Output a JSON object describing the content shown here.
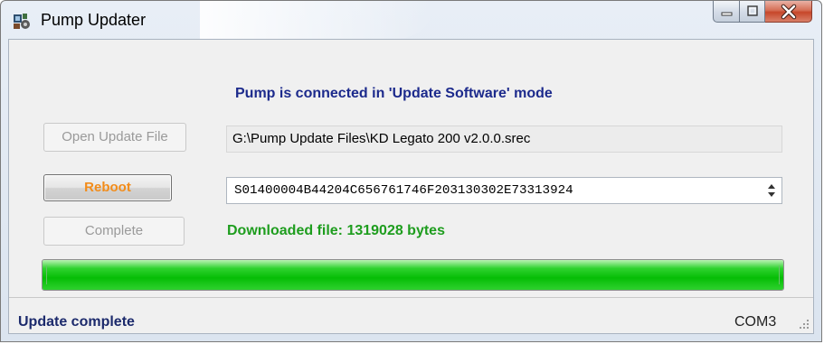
{
  "window": {
    "title": "Pump Updater",
    "icon": "pump-updater-app-icon",
    "caption_buttons": [
      "minimize-icon",
      "maximize-icon",
      "close-icon"
    ]
  },
  "main": {
    "connection_status": "Pump is connected in 'Update Software' mode",
    "open_file_button": "Open Update File",
    "file_path": "G:\\Pump Update Files\\KD Legato 200 v2.0.0.srec",
    "reboot_button": "Reboot",
    "srec_line": "S01400004B44204C656761746F203130302E73313924",
    "complete_button": "Complete",
    "download_message": "Downloaded file: 1319028 bytes",
    "progress_percent": 100
  },
  "statusbar": {
    "message": "Update complete",
    "port": "COM3"
  },
  "colors": {
    "status_text": "#1c2a8c",
    "reboot_text": "#f28c1a",
    "download_text": "#1e9d1e",
    "progress_green": "#06bd06",
    "close_button": "#c7472a"
  }
}
